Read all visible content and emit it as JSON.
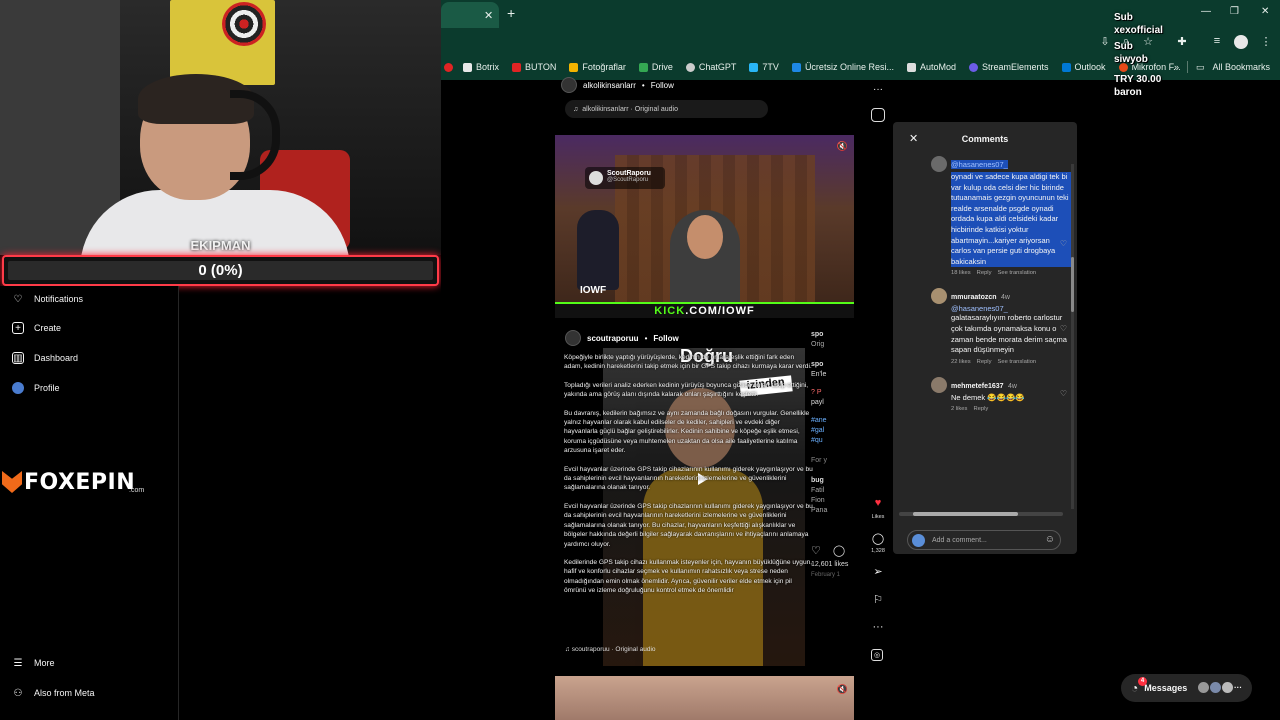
{
  "webcam": {
    "name_label": "EKIPMAN"
  },
  "goal": {
    "text": "0 (0%)",
    "progress": 0,
    "accent": "#ff3b48"
  },
  "sidebar": {
    "items": [
      {
        "label": "Notifications",
        "icon": "heart-icon"
      },
      {
        "label": "Create",
        "icon": "plus-icon"
      },
      {
        "label": "Dashboard",
        "icon": "dashboard-icon"
      },
      {
        "label": "Profile",
        "icon": "avatar"
      },
      {
        "label": "More",
        "icon": "menu-icon"
      },
      {
        "label": "Also from Meta",
        "icon": "meta-icon"
      }
    ]
  },
  "brand": {
    "name": "FOXEPIN",
    "suffix": ".com",
    "color": "#f06a1a"
  },
  "browser": {
    "tab_close": "✕",
    "new_tab": "+",
    "bookmarks": [
      {
        "label": "Botrix",
        "color": "#e8e8e8"
      },
      {
        "label": "BUTON",
        "color": "#e02424"
      },
      {
        "label": "Fotoğraflar",
        "color": "#f4b400"
      },
      {
        "label": "Drive",
        "color": "#34a853"
      },
      {
        "label": "ChatGPT",
        "color": "#cccccc"
      },
      {
        "label": "7TV",
        "color": "#29b6f6"
      },
      {
        "label": "Ücretsiz Online Resi...",
        "color": "#1e88e5"
      },
      {
        "label": "AutoMod",
        "color": "#dddddd"
      },
      {
        "label": "StreamElements",
        "color": "#6c5ce7"
      },
      {
        "label": "Outlook",
        "color": "#0078d4"
      },
      {
        "label": "Mikrofon F...",
        "color": "#e64a19"
      }
    ],
    "all_bookmarks": "All Bookmarks",
    "more": "»"
  },
  "overlay": {
    "lines": [
      "Sub",
      "xexofficial",
      "Sub",
      "siwyob",
      "TRY 30.00",
      "baron"
    ]
  },
  "post1": {
    "username": "alkolikinsanlarr",
    "follow": "Follow",
    "audio": "alkolikinsanlarr · Original audio",
    "badge_name": "ScoutRaporu",
    "badge_handle": "@ScoutRaporu",
    "char_label": "IOWF",
    "kick_prefix": "KICK",
    "kick_suffix": ".COM/IOWF"
  },
  "post2": {
    "username": "scoutraporuu",
    "follow": "Follow",
    "overlay_title": "Doğru",
    "overlay_sub": "izinden",
    "paragraphs": [
      "Köpeğiyle birlikte yaptığı yürüyüşlerde, kedinin de onlara eşlik ettiğini fark eden adam, kedinin hareketlerini takip etmek için bir GPS takip cihazı kurmaya karar verdi.",
      "Topladığı verileri analiz ederken kedinin yürüyüş boyunca gizlice onları takip ettiğini, yakında ama görüş alanı dışında kalarak onları şaşırttığını keşfetti.",
      "Bu davranış, kedilerin bağımsız ve aynı zamanda bağlı doğasını vurgular. Genellikle yalnız hayvanlar olarak kabul edilseler de kediler, sahipleri ve evdeki diğer hayvanlarla güçlü bağlar geliştirebilirler. Kedinin sahibine ve köpeğe eşlik etmesi, koruma içgüdüsüne veya muhtemelen uzaktan da olsa aile faaliyetlerine katılma arzusuna işaret eder.",
      "Evcil hayvanlar üzerinde GPS takip cihazlarının kullanımı giderek yaygınlaşıyor ve bu da sahiplerinin evcil hayvanlarının hareketlerini izlemelerine ve güvenliklerini sağlamalarına olanak tanıyor.",
      "Evcil hayvanlar üzerinde GPS takip cihazlarının kullanımı giderek yaygınlaşıyor ve bu da sahiplerinin evcil hayvanlarının hareketlerini izlemelerine ve güvenliklerini sağlamalarına olanak tanıyor. Bu cihazlar, hayvanların keşfettiği alışkanlıklar ve bölgeler hakkında değerli bilgiler sağlayarak davranışlarını ve ihtiyaçlarını anlamaya yardımcı oluyor.",
      "Kedilerinde GPS takip cihazı kullanmak isteyenler için, hayvanın büyüklüğüne uygun, hafif ve konforlu cihazlar seçmek ve kullanımın rahatsızlık veya strese neden olmadığından emin olmak önemlidir. Ayrıca, güvenilir veriler elde etmek için pil ömrünü ve izleme doğruluğunu kontrol etmek de önemlidir"
    ],
    "audio": "scoutraporuu · Original audio"
  },
  "peek": {
    "lines": [
      "spo",
      "Orig",
      "spo",
      "En'le",
      "? P",
      "payl",
      "#ane",
      "#gal",
      "#qu",
      "For y",
      "bug",
      "Fatil",
      "Fion",
      "Pana"
    ],
    "likes": "12,601 likes",
    "date": "February 1"
  },
  "actions": {
    "likes_label": "Likes",
    "comments_count": "1,328"
  },
  "comments": {
    "title": "Comments",
    "close": "✕",
    "items": [
      {
        "user": "",
        "time": "",
        "mention": "@hasanenes07_",
        "text": "oynadi ve sadece kupa aldigi tek bi var kulup oda celsi dier hic birinde tutuanamais gezgin oyuncunun teki realde arsenalde psgde oynadi ordada kupa aldi celsideki kadar hicbirinde katkisi yoktur abartmayin...kariyer ariyorsan carlos van persie guti drogbaya bakicaksin",
        "likes": "18 likes",
        "reply": "Reply",
        "translate": "See translation",
        "selected": true
      },
      {
        "user": "mmuraatozcn",
        "time": "4w",
        "mention": "@hasanenes07_",
        "text": "galatasaraylıyım roberto carlostur çok takımda oynamaksa konu o zaman bende morata derim saçma sapan düşünmeyin",
        "likes": "22 likes",
        "reply": "Reply",
        "translate": "See translation",
        "selected": false
      },
      {
        "user": "mehmetefe1637",
        "time": "4w",
        "mention": "",
        "text": "Ne demek 😂😂😂😂",
        "likes": "2 likes",
        "reply": "Reply",
        "translate": "",
        "selected": false
      }
    ],
    "add_placeholder": "Add a comment..."
  },
  "messages": {
    "label": "Messages",
    "badge": "4"
  }
}
